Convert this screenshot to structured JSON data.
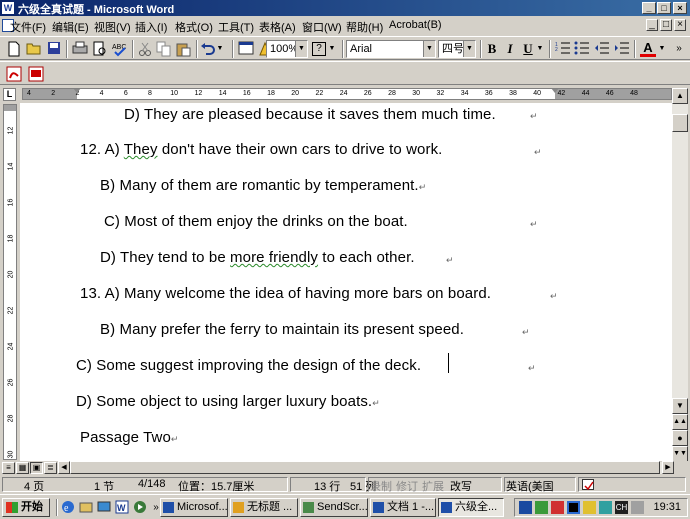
{
  "window": {
    "title": "六级全真试题 - Microsoft Word",
    "controls": {
      "minimize": "_",
      "restore": "□",
      "close": "×"
    }
  },
  "menu": {
    "items": [
      "文件(F)",
      "编辑(E)",
      "视图(V)",
      "插入(I)",
      "格式(O)",
      "工具(T)",
      "表格(A)",
      "窗口(W)",
      "帮助(H)",
      "Acrobat(B)"
    ]
  },
  "toolbar": {
    "zoom": "100%",
    "font": "Arial",
    "size": "四号",
    "help": "?"
  },
  "ruler": {
    "marks": [
      "4",
      "2",
      "2",
      "4",
      "6",
      "8",
      "10",
      "12",
      "14",
      "16",
      "18",
      "20",
      "22",
      "24",
      "26",
      "28",
      "30",
      "32",
      "34",
      "36",
      "38",
      "40",
      "42",
      "44",
      "46",
      "48"
    ],
    "corner": "L"
  },
  "vruler": {
    "marks": [
      "12",
      "14",
      "16",
      "18",
      "20",
      "22",
      "24",
      "26",
      "28",
      "30"
    ]
  },
  "document": {
    "lines": [
      "D) They are pleased because it saves them much time.",
      "12. A) They don't have their own cars to drive to work.",
      "B) Many of them are romantic by temperament.",
      "C) Most of them enjoy the drinks on the boat.",
      "D) They tend to be more friendly to each other.",
      "13. A) Many welcome the idea of having more bars on board.",
      "B) Many prefer the ferry to maintain its present speed.",
      "C) Some suggest improving the design of the deck.",
      "D) Some object to using larger luxury boats.",
      "Passage Two"
    ],
    "paragraph_mark": "↵"
  },
  "status": {
    "page": "4 页",
    "section": "1 节",
    "page_of": "4/148",
    "position": "位置：15.7厘米",
    "line": "13 行",
    "column": "51 列",
    "rec": "录制",
    "trk": "修订",
    "ext": "扩展",
    "ovr": "改写",
    "language": "英语(美国"
  },
  "taskbar": {
    "start": "开始",
    "tasks": [
      "Microsof...",
      "无标题 ...",
      "SendScr...",
      "文档 1 -...",
      "六级全..."
    ],
    "clock": "19:31"
  }
}
